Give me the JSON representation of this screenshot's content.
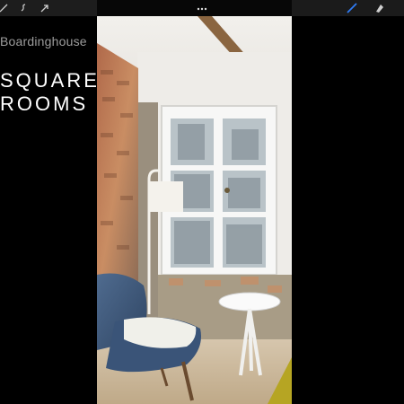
{
  "toolbar": {
    "left_tools": [
      "pen-tool-icon",
      "smudge-tool-icon",
      "selection-arrow-icon"
    ],
    "center_menu": "more-dots-icon",
    "right_tools": [
      "brush-tool-icon",
      "eraser-tool-icon"
    ],
    "accent_color": "#2f7cf6"
  },
  "brand": {
    "name": "Boardinghouse",
    "headline_line1": "SQUARE",
    "headline_line2": "ROOMS"
  },
  "photo": {
    "subject": "room-interior-photo"
  }
}
